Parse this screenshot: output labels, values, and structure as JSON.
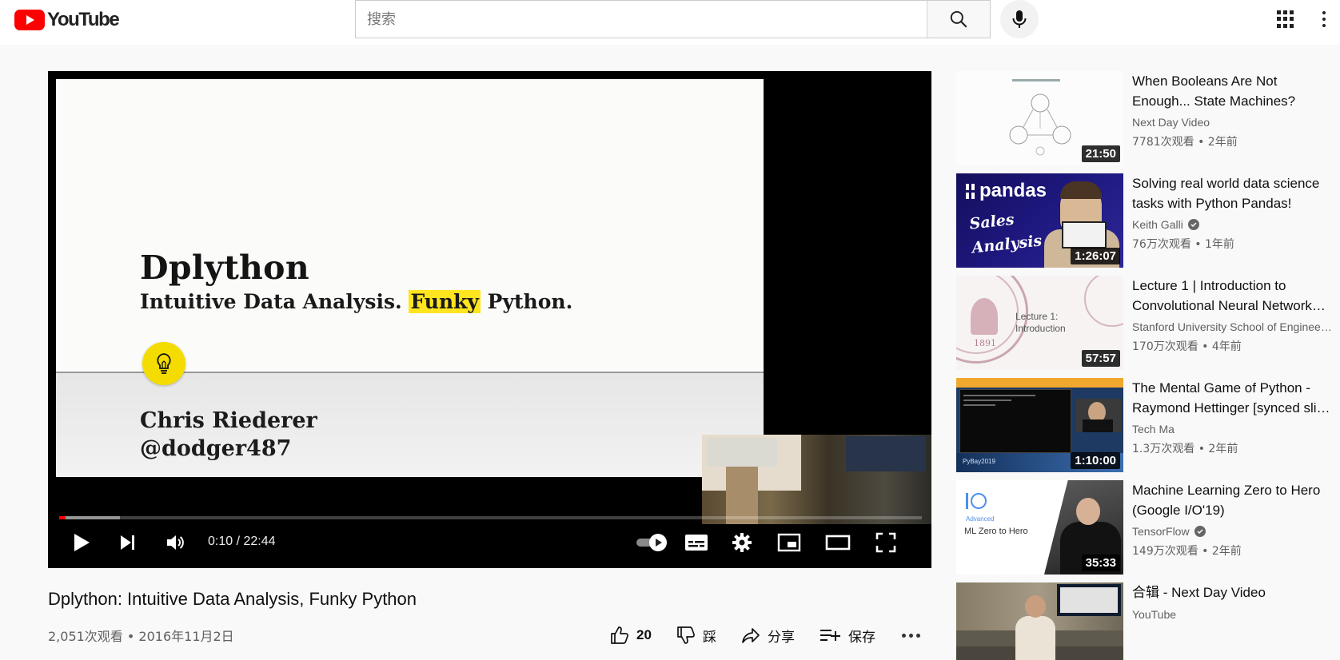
{
  "header": {
    "logo_text": "YouTube",
    "search_placeholder": "搜索",
    "search_value": ""
  },
  "player": {
    "slide": {
      "title": "Dplython",
      "subtitle_before": "Intuitive Data Analysis. ",
      "subtitle_highlight": "Funky",
      "subtitle_after": " Python.",
      "author_name": "Chris Riederer",
      "author_handle": "@dodger487"
    },
    "time_current": "0:10",
    "time_separator": " / ",
    "time_total": "22:44",
    "progress_played_fraction": 0.007,
    "progress_buffered_fraction": 0.07,
    "accent_color": "#ff0000"
  },
  "video": {
    "title": "Dplython: Intuitive Data Analysis, Funky Python",
    "meta": "2,051次观看 • 2016年11月2日",
    "like_count": "20",
    "dislike_label": "踩",
    "share_label": "分享",
    "save_label": "保存"
  },
  "recommendations": [
    {
      "title_line1": "When Booleans Are Not",
      "title_line2": "Enough... State Machines?",
      "channel": "Next Day Video",
      "verified": false,
      "stats": "7781次观看 • 2年前",
      "duration": "21:50"
    },
    {
      "title_line1": "Solving real world data science",
      "title_line2": "tasks with Python Pandas!",
      "channel": "Keith Galli",
      "verified": true,
      "stats": "76万次观看 • 1年前",
      "duration": "1:26:07",
      "thumb_text_brand": "pandas",
      "thumb_text_line1": "Sales",
      "thumb_text_line2": "Analysis"
    },
    {
      "title_line1": "Lecture 1 | Introduction to",
      "title_line2": "Convolutional Neural Networks for Visual Recognition",
      "channel": "Stanford University School of Engineering",
      "verified": false,
      "stats": "170万次观看 • 4年前",
      "duration": "57:57",
      "thumb_text_line1": "Lecture 1:",
      "thumb_text_line2": "Introduction",
      "thumb_year": "1891"
    },
    {
      "title_line1": "The Mental Game of Python -",
      "title_line2": "Raymond Hettinger [synced slides]",
      "channel": "Tech Ma",
      "verified": false,
      "stats": "1.3万次观看 • 2年前",
      "duration": "1:10:00",
      "thumb_text": "PyBay2019"
    },
    {
      "title_line1": "Machine Learning Zero to Hero",
      "title_line2": "(Google I/O'19)",
      "channel": "TensorFlow",
      "verified": true,
      "stats": "149万次观看 • 2年前",
      "duration": "35:33",
      "thumb_text_small": "Advanced",
      "thumb_text": "ML Zero to Hero"
    },
    {
      "title_line1": "合辑 - Next Day Video",
      "title_line2": "",
      "channel": "YouTube",
      "verified": false,
      "stats": "",
      "duration": ""
    }
  ]
}
